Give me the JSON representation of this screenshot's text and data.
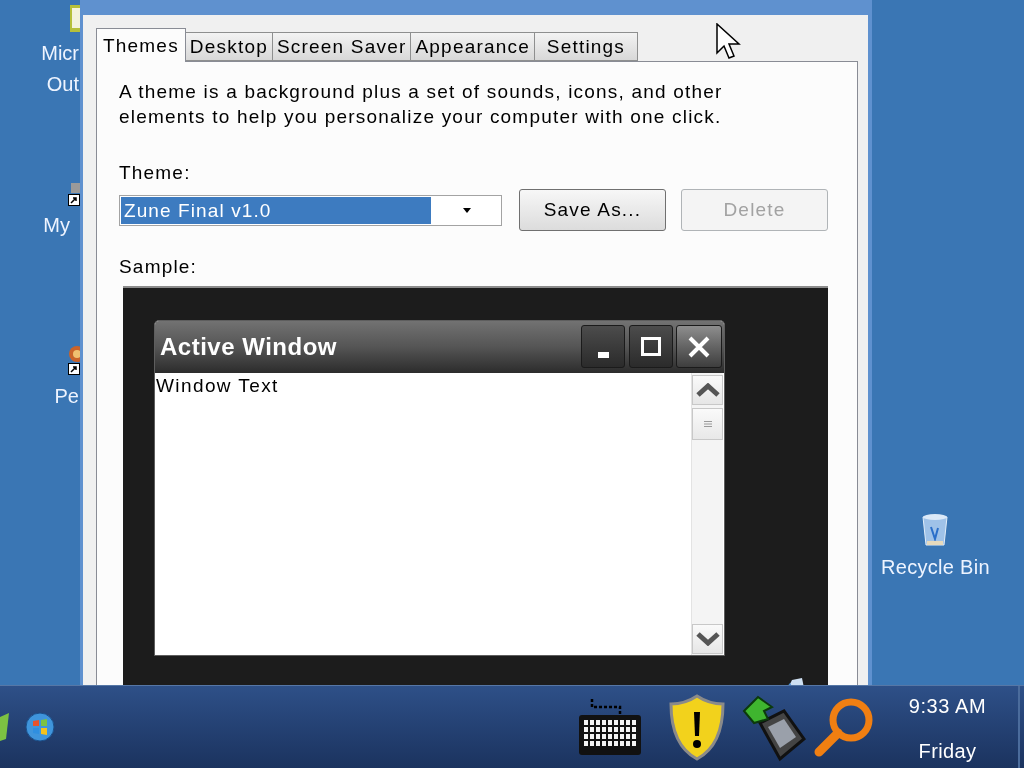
{
  "desktop": {
    "icons": [
      {
        "label_lines": [
          "Micr",
          "Out"
        ]
      },
      {
        "label_lines": [
          "My"
        ]
      },
      {
        "label_lines": [
          "Pe"
        ]
      }
    ],
    "recycle_bin": {
      "label": "Recycle Bin"
    }
  },
  "dialog": {
    "tabs": [
      {
        "label": "Themes",
        "selected": true
      },
      {
        "label": "Desktop",
        "selected": false
      },
      {
        "label": "Screen Saver",
        "selected": false
      },
      {
        "label": "Appearance",
        "selected": false
      },
      {
        "label": "Settings",
        "selected": false
      }
    ],
    "description": "A theme is a background plus a set of sounds, icons, and other elements to help you personalize your computer with one click.",
    "theme_label": "Theme:",
    "theme_dropdown": {
      "value": "Zune Final v1.0",
      "highlighted": true
    },
    "buttons": [
      {
        "label": "Save As...",
        "disabled": false
      },
      {
        "label": "Delete",
        "disabled": true
      }
    ],
    "sample_label": "Sample:",
    "sample": {
      "window_title": "Active Window",
      "window_text": "Window Text"
    }
  },
  "taskbar": {
    "clock": {
      "time": "9:33 AM",
      "day": "Friday"
    }
  }
}
